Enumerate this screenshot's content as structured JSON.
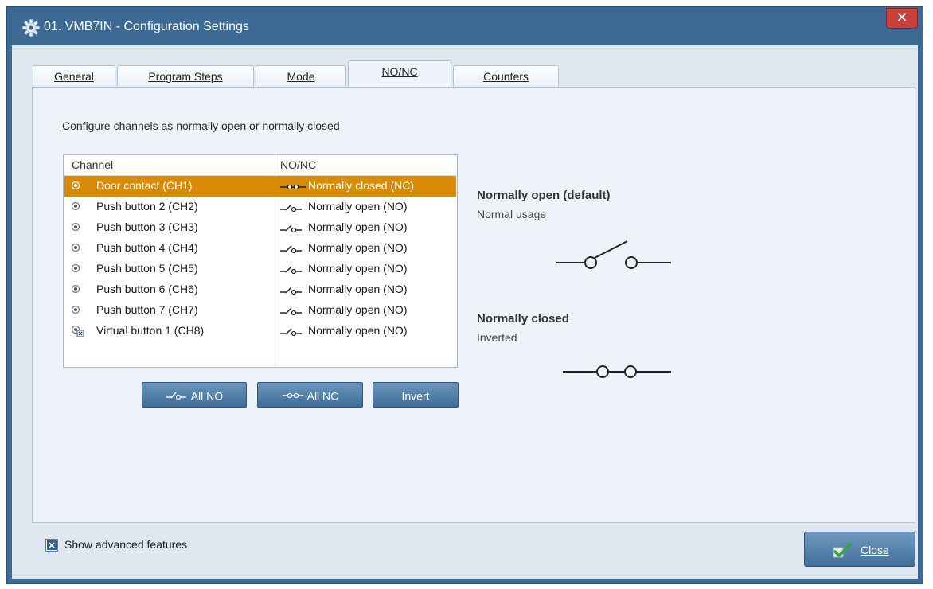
{
  "window": {
    "title": "01. VMB7IN - Configuration Settings",
    "close_glyph": "✕"
  },
  "tabs": [
    {
      "label": "General",
      "active": false
    },
    {
      "label": "Program Steps",
      "active": false
    },
    {
      "label": "Mode",
      "active": false
    },
    {
      "label": "NO/NC",
      "active": true
    },
    {
      "label": "Counters",
      "active": false
    }
  ],
  "panel": {
    "heading": "Configure channels as normally open or normally closed"
  },
  "list": {
    "columns": {
      "channel": "Channel",
      "state": "NO/NC"
    },
    "rows": [
      {
        "channel": "Door contact (CH1)",
        "state": "Normally closed (NC)",
        "icon": "radio-icon",
        "switch": "closed-switch-icon",
        "selected": true
      },
      {
        "channel": "Push button 2 (CH2)",
        "state": "Normally open (NO)",
        "icon": "radio-icon",
        "switch": "open-switch-icon",
        "selected": false
      },
      {
        "channel": "Push button 3 (CH3)",
        "state": "Normally open (NO)",
        "icon": "radio-icon",
        "switch": "open-switch-icon",
        "selected": false
      },
      {
        "channel": "Push button 4 (CH4)",
        "state": "Normally open (NO)",
        "icon": "radio-icon",
        "switch": "open-switch-icon",
        "selected": false
      },
      {
        "channel": "Push button 5 (CH5)",
        "state": "Normally open (NO)",
        "icon": "radio-icon",
        "switch": "open-switch-icon",
        "selected": false
      },
      {
        "channel": "Push button 6 (CH6)",
        "state": "Normally open (NO)",
        "icon": "radio-icon",
        "switch": "open-switch-icon",
        "selected": false
      },
      {
        "channel": "Push button 7 (CH7)",
        "state": "Normally open (NO)",
        "icon": "radio-icon",
        "switch": "open-switch-icon",
        "selected": false
      },
      {
        "channel": "Virtual button 1 (CH8)",
        "state": "Normally open (NO)",
        "icon": "virtual-button-icon",
        "switch": "open-switch-icon",
        "selected": false
      }
    ]
  },
  "buttons": {
    "all_no": "All NO",
    "all_nc": "All NC",
    "invert": "Invert"
  },
  "legend": {
    "open_title": "Normally open (default)",
    "open_sub": "Normal usage",
    "closed_title": "Normally closed",
    "closed_sub": "Inverted"
  },
  "footer": {
    "advanced_label": "Show advanced features",
    "advanced_checked": true,
    "close_label": "Close"
  },
  "colors": {
    "selection": "#d98b07",
    "window_frame": "#3d6a94",
    "button": "#4f7ba6"
  }
}
